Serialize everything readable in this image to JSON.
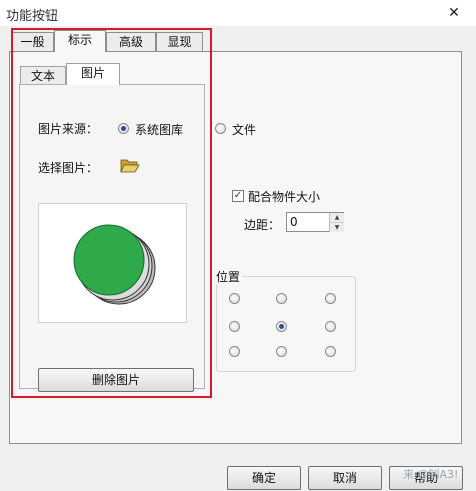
{
  "window": {
    "title": "功能按钮",
    "close_glyph": "✕"
  },
  "outer_tabs": [
    {
      "label": "一般"
    },
    {
      "label": "标示"
    },
    {
      "label": "高级"
    },
    {
      "label": "显现"
    }
  ],
  "inner_tabs": [
    {
      "label": "文本"
    },
    {
      "label": "图片"
    }
  ],
  "picture_source": {
    "label": "图片来源：",
    "options": [
      {
        "label": "系统图库",
        "selected": true
      },
      {
        "label": "文件",
        "selected": false
      }
    ]
  },
  "select_picture": {
    "label": "选择图片：",
    "icon": "folder-open-icon"
  },
  "preview": {
    "image": "green-circle-button-icon",
    "colors": {
      "fill": "#2eaa4a",
      "shadow": "#4a4a4a"
    }
  },
  "delete_button": {
    "label": "删除图片"
  },
  "fit_object": {
    "label": "配合物件大小",
    "checked": true,
    "check_glyph": "✓"
  },
  "margin": {
    "label": "边距：",
    "value": "0",
    "up_glyph": "▲",
    "down_glyph": "▼"
  },
  "position": {
    "label": "位置",
    "selected_index": 4
  },
  "footer": {
    "ok": "确定",
    "cancel": "取消",
    "help": "帮助"
  },
  "watermark": "来 @钊A3!",
  "colors": {
    "highlight_frame": "#d8192a",
    "radio_dot": "#2b4c9a"
  }
}
